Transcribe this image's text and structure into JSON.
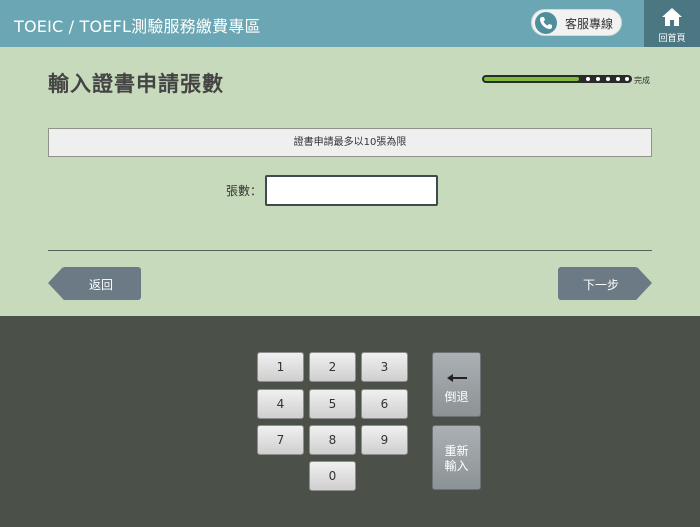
{
  "header": {
    "title": "TOEIC / TOEFL測驗服務繳費專區",
    "service_label": "客服專線",
    "home_label": "回首頁"
  },
  "main": {
    "page_title": "輸入證書申請張數",
    "progress": {
      "fraction": 0.65,
      "label": "完成"
    },
    "notice": "證書申請最多以10張為限",
    "field_label": "張數：",
    "field_value": "",
    "back_label": "返回",
    "next_label": "下一步"
  },
  "keypad": {
    "keys": [
      "1",
      "2",
      "3",
      "4",
      "5",
      "6",
      "7",
      "8",
      "9",
      "0"
    ],
    "backspace_label": "倒退",
    "reset_label_line1": "重新",
    "reset_label_line2": "輸入"
  },
  "colors": {
    "header_bg": "#6aa6b3",
    "home_bg": "#4a7782",
    "main_bg": "#c8dabc",
    "keypad_bg": "#4b5148",
    "nav_button": "#6c7a85",
    "progress_fill": "#7dbb3a"
  },
  "icons": {
    "service": "phone-icon",
    "home": "home-icon",
    "backspace": "left-arrow-icon"
  }
}
